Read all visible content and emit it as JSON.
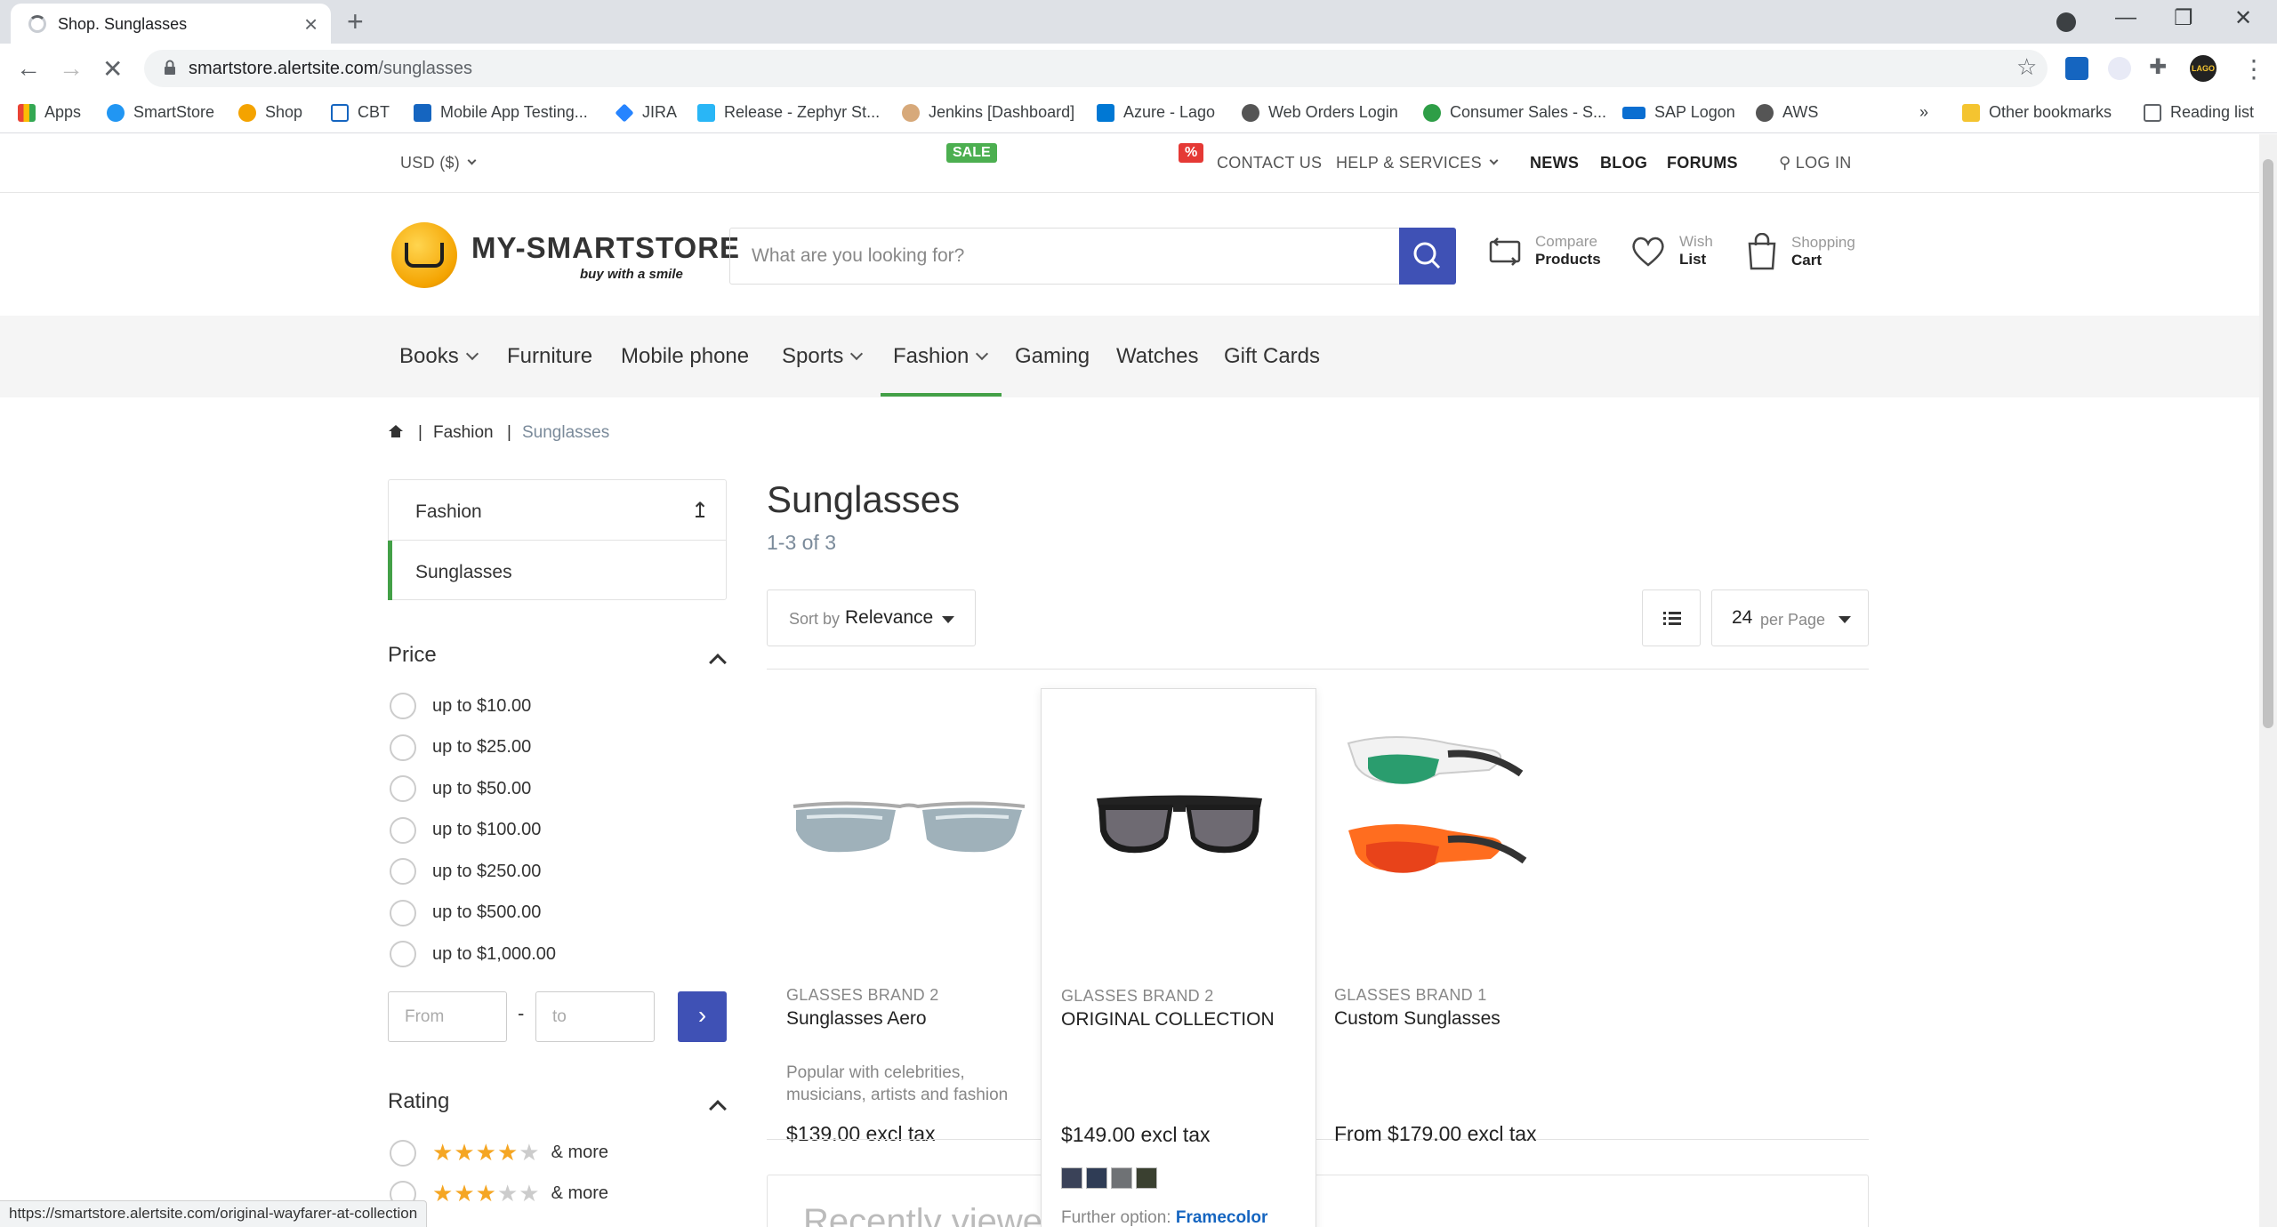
{
  "browser": {
    "tab_title": "Shop. Sunglasses",
    "url_host": "smartstore.alertsite.com",
    "url_path": "/sunglasses",
    "status_url": "https://smartstore.alertsite.com/original-wayfarer-at-collection",
    "bookmarks": [
      "Apps",
      "SmartStore",
      "Shop",
      "CBT",
      "Mobile App Testing...",
      "JIRA",
      "Release - Zephyr St...",
      "Jenkins [Dashboard]",
      "Azure - Lago",
      "Web Orders Login",
      "Consumer Sales - S...",
      "SAP Logon",
      "AWS"
    ],
    "overflow": "»",
    "other_bookmarks": "Other bookmarks",
    "reading_list": "Reading list",
    "profile_initials": "LAGO"
  },
  "topbar": {
    "currency": "USD ($)",
    "contact": "CONTACT US",
    "help": "HELP & SERVICES",
    "news": "NEWS",
    "blog": "BLOG",
    "forums": "FORUMS",
    "login": "LOG IN"
  },
  "header": {
    "logo_text": "MY-SMARTSTORE",
    "logo_tagline": "buy with a smile",
    "search_placeholder": "What are you looking for?",
    "compare_l1": "Compare",
    "compare_l2": "Products",
    "wish_l1": "Wish",
    "wish_l2": "List",
    "cart_l1": "Shopping",
    "cart_l2": "Cart"
  },
  "nav": {
    "books": "Books",
    "furniture": "Furniture",
    "mobile": "Mobile phone",
    "sports": "Sports",
    "fashion": "Fashion",
    "fashion_badge": "SALE",
    "gaming": "Gaming",
    "watches": "Watches",
    "watches_badge": "%",
    "gift": "Gift Cards"
  },
  "breadcrumb": {
    "sep": "|",
    "fashion": "Fashion",
    "current": "Sunglasses"
  },
  "sidebar": {
    "parent": "Fashion",
    "child": "Sunglasses",
    "price_title": "Price",
    "prices": [
      "up to $10.00",
      "up to $25.00",
      "up to $50.00",
      "up to $100.00",
      "up to $250.00",
      "up to $500.00",
      "up to $1,000.00"
    ],
    "from_placeholder": "From",
    "to_placeholder": "to",
    "range_sep": "-",
    "rating_title": "Rating",
    "rating_more": "& more",
    "ratings": [
      4,
      3
    ]
  },
  "main": {
    "title": "Sunglasses",
    "count": "1-3 of 3",
    "sort_prefix": "Sort by",
    "sort_value": "Relevance",
    "per_page_num": "24",
    "per_page_label": "per Page",
    "recent_title": "Recently viewed"
  },
  "products": [
    {
      "brand": "GLASSES BRAND 2",
      "name": "Sunglasses Aero",
      "desc": "Popular with celebrities, musicians, artists and fashion",
      "price": "$139.00 excl tax"
    },
    {
      "brand": "GLASSES BRAND 2",
      "name": "ORIGINAL COLLECTION",
      "price": "$149.00 excl tax",
      "swatch_colors": [
        "#3a4258",
        "#2f3c55",
        "#6f7275",
        "#3a4030"
      ],
      "further_prefix": "Further option:",
      "further_value": "Framecolor"
    },
    {
      "brand": "GLASSES BRAND 1",
      "name": "Custom Sunglasses",
      "price": "From $179.00 excl tax"
    }
  ],
  "colors": {
    "accent": "#3f51b5",
    "green": "#43a047",
    "sale_badge": "#4caf50",
    "pct_badge": "#e53935",
    "star": "#f5a623"
  }
}
